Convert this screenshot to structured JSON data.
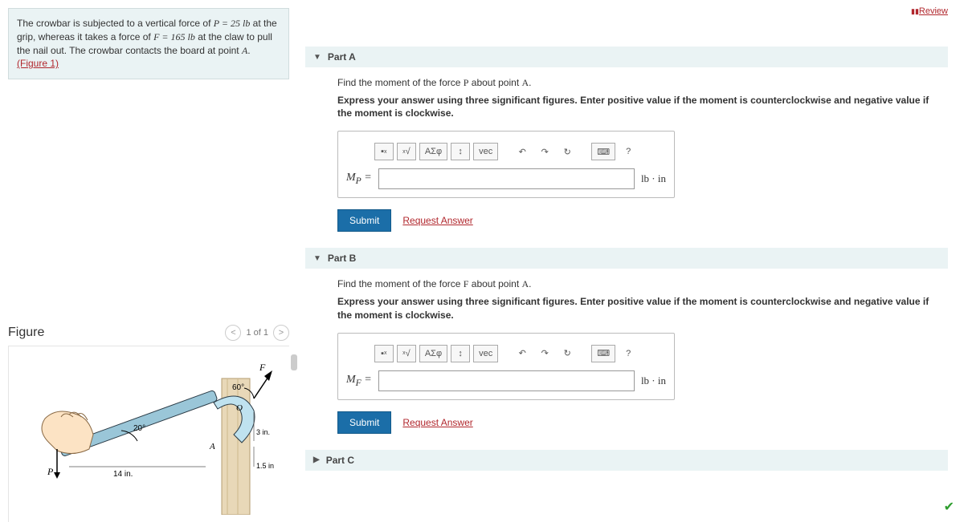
{
  "review": "Review",
  "problem": {
    "text_pre": "The crowbar is subjected to a vertical force of ",
    "p_eq": "P = 25  lb",
    "text_mid": " at the grip, whereas it takes a force of ",
    "f_eq": "F = 165  lb",
    "text_post": " at the claw to pull the nail out. The crowbar contacts the board at point ",
    "a_var": "A",
    "period": ".",
    "figure_link": "(Figure 1)"
  },
  "figure_panel": {
    "title": "Figure",
    "nav": "1 of 1",
    "prev": "<",
    "next": ">",
    "labels": {
      "angle20": "20°",
      "angle60": "60°",
      "len14": "14 in.",
      "len3": "3 in.",
      "len15": "1.5 in.",
      "P": "P",
      "F": "F",
      "O": "O",
      "A": "A"
    }
  },
  "partA": {
    "header": "Part A",
    "prompt_pre": "Find the moment of the force ",
    "prompt_var": "P",
    "prompt_post": " about point ",
    "prompt_a": "A",
    "instr": "Express your answer using three significant figures. Enter positive value if the moment is counterclockwise and negative value if the moment is clockwise.",
    "label": "M",
    "label_sub": "P",
    "eq": " = ",
    "unit": "lb · in",
    "submit": "Submit",
    "request": "Request Answer"
  },
  "partB": {
    "header": "Part B",
    "prompt_pre": "Find the moment of the force ",
    "prompt_var": "F",
    "prompt_post": " about point ",
    "prompt_a": "A",
    "instr": "Express your answer using three significant figures. Enter positive value if the moment is counterclockwise and negative value if the moment is clockwise.",
    "label": "M",
    "label_sub": "F",
    "eq": " = ",
    "unit": "lb · in",
    "submit": "Submit",
    "request": "Request Answer"
  },
  "partC": {
    "header": "Part C"
  },
  "toolbar": {
    "template": "▪",
    "sqrt": "√",
    "greek": "ΑΣφ",
    "arrows": "↕",
    "vec": "vec",
    "undo": "↶",
    "redo": "↷",
    "reset": "↻",
    "keyboard": "⌨",
    "help": "?"
  }
}
